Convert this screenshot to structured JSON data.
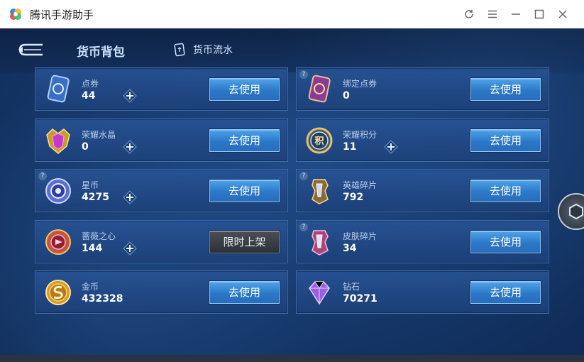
{
  "window": {
    "title": "腾讯手游助手",
    "controls": [
      "refresh-icon",
      "menu-icon",
      "minimize-icon",
      "maximize-icon",
      "close-icon"
    ]
  },
  "header": {
    "back_icon": "back-arrow-icon",
    "tab_bag": "货币背包",
    "tab_flow": "货币流水",
    "tab_flow_icon": "card-icon"
  },
  "left_cards": [
    {
      "name": "点券",
      "value": "44",
      "button": "去使用",
      "icon": "coupon-card-icon",
      "has_plus": true,
      "has_help": false
    },
    {
      "name": "荣耀水晶",
      "value": "0",
      "button": "去使用",
      "icon": "glory-crystal-icon",
      "has_plus": true,
      "has_help": false
    },
    {
      "name": "星币",
      "value": "4275",
      "button": "去使用",
      "icon": "star-coin-icon",
      "has_plus": true,
      "has_help": true
    },
    {
      "name": "蔷薇之心",
      "value": "144",
      "button": "限时上架",
      "icon": "rose-heart-icon",
      "has_plus": true,
      "has_help": false
    },
    {
      "name": "金币",
      "value": "432328",
      "button": "去使用",
      "icon": "gold-coin-icon",
      "has_plus": false,
      "has_help": false
    }
  ],
  "right_cards": [
    {
      "name": "绑定点券",
      "value": "0",
      "button": "去使用",
      "icon": "bound-coupon-card-icon",
      "has_plus": false,
      "has_help": true
    },
    {
      "name": "荣耀积分",
      "value": "11",
      "button": "去使用",
      "icon": "glory-points-icon",
      "has_plus": true,
      "has_help": false
    },
    {
      "name": "英雄碎片",
      "value": "792",
      "button": "去使用",
      "icon": "hero-fragment-icon",
      "has_plus": false,
      "has_help": true
    },
    {
      "name": "皮肤碎片",
      "value": "34",
      "button": "去使用",
      "icon": "skin-fragment-icon",
      "has_plus": false,
      "has_help": true
    },
    {
      "name": "钻石",
      "value": "70271",
      "button": "去使用",
      "icon": "diamond-icon",
      "has_plus": false,
      "has_help": false
    }
  ],
  "colors": {
    "accent": "#2b78c9",
    "panel": "#1d4078",
    "background": "#163a6e"
  }
}
